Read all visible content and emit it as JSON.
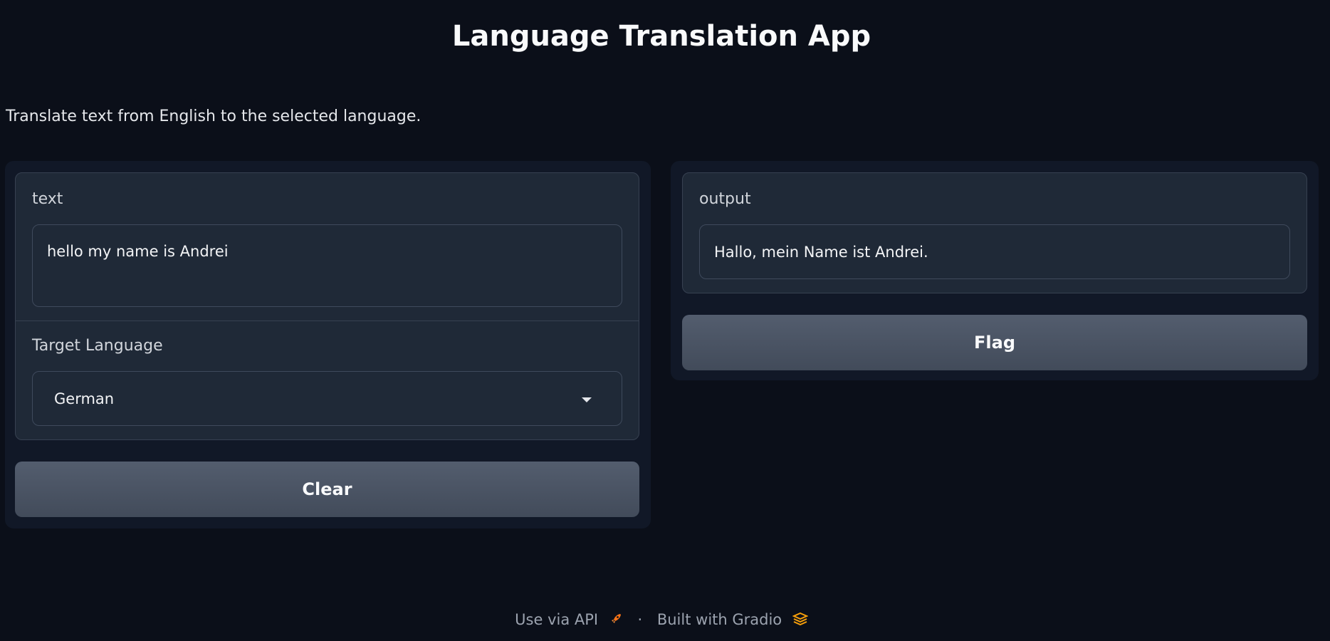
{
  "app": {
    "title": "Language Translation App",
    "description": "Translate text from English to the selected language."
  },
  "input": {
    "text_label": "text",
    "text_value": "hello my name is Andrei",
    "language_label": "Target Language",
    "language_value": "German",
    "clear_label": "Clear"
  },
  "output": {
    "label": "output",
    "value": "Hallo, mein Name ist Andrei.",
    "flag_label": "Flag"
  },
  "footer": {
    "api_label": "Use via API",
    "separator": "·",
    "built_label": "Built with Gradio"
  },
  "colors": {
    "background": "#0b0f19",
    "panel": "#111827",
    "block": "#1f2937",
    "button": "#4b5563",
    "accent": "#f97316"
  },
  "icons": {
    "api": "rocket-icon",
    "gradio": "gradio-logo-icon",
    "dropdown": "chevron-down-icon"
  }
}
